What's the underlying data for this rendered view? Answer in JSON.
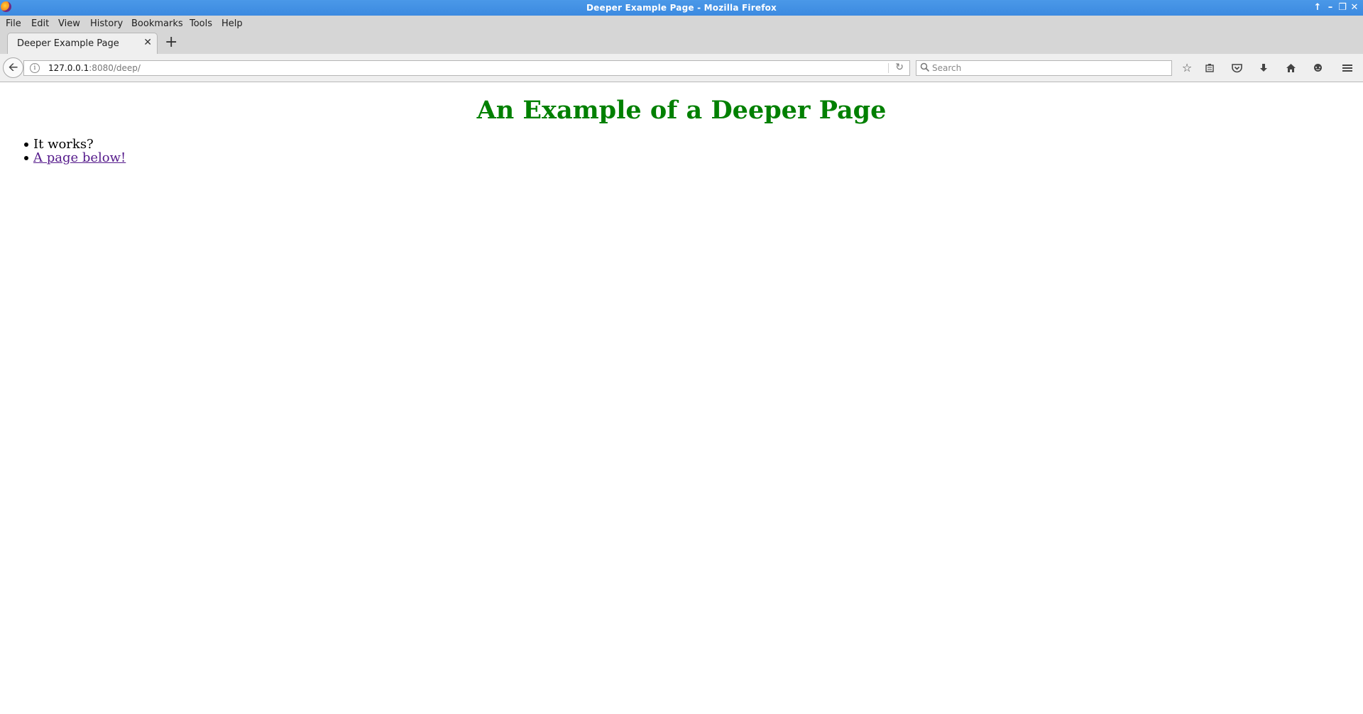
{
  "window": {
    "title": "Deeper Example Page - Mozilla Firefox"
  },
  "menu": {
    "items": [
      "File",
      "Edit",
      "View",
      "History",
      "Bookmarks",
      "Tools",
      "Help"
    ]
  },
  "tabs": [
    {
      "label": "Deeper Example Page"
    }
  ],
  "navbar": {
    "url_host": "127.0.0.1",
    "url_path": ":8080/deep/",
    "search_placeholder": "Search"
  },
  "page": {
    "heading": "An Example of a Deeper Page",
    "list": [
      {
        "text": "It works?"
      },
      {
        "text": "A page below!",
        "is_link": true
      }
    ],
    "heading_color": "#008000",
    "visited_link_color": "#551a8b"
  },
  "icons": [
    "firefox-icon",
    "window-minimize-icon",
    "window-restore-icon",
    "window-close-icon",
    "tab-close-icon",
    "new-tab-icon",
    "back-arrow-icon",
    "info-icon",
    "reload-icon",
    "search-icon",
    "bookmark-star-icon",
    "reading-list-icon",
    "pocket-icon",
    "download-icon",
    "home-icon",
    "chat-icon",
    "hamburger-menu-icon"
  ]
}
